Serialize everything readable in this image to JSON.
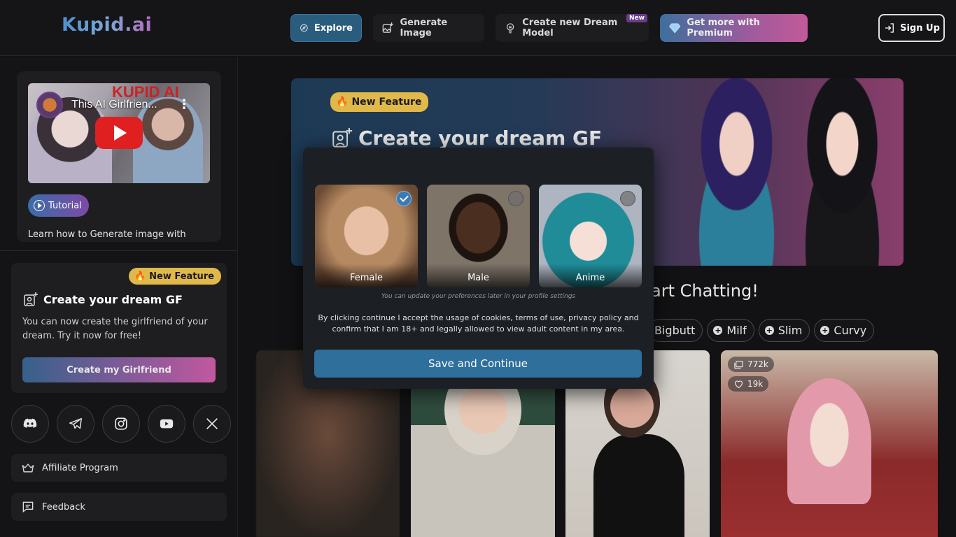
{
  "brand": {
    "logo": "Kupid.ai"
  },
  "nav": {
    "explore": "Explore",
    "generate": "Generate Image",
    "dream_model": "Create new Dream Model",
    "dream_model_tag": "New",
    "premium": "Get more with Premium",
    "signup": "Sign Up"
  },
  "sidebar": {
    "video": {
      "title": "This AI Girlfrien...",
      "overlay_text": "KUPID AI"
    },
    "tutorial_label": "Tutorial",
    "video_desc": "Learn how to Generate image with",
    "gf_card": {
      "badge": "New Feature",
      "title": "Create your dream GF",
      "desc": "You can now create the girlfriend of your dream. Try it now for free!",
      "button": "Create my Girlfriend"
    },
    "socials": [
      "discord-icon",
      "telegram-icon",
      "instagram-icon",
      "youtube-icon",
      "x-icon"
    ],
    "affiliate": "Affiliate Program",
    "feedback": "Feedback"
  },
  "main": {
    "banner": {
      "badge": "New Feature",
      "title": "Create your dream GF"
    },
    "start_chatting": "art Chatting!",
    "tags": [
      "Bigbutt",
      "Milf",
      "Slim",
      "Curvy"
    ],
    "card_stats": {
      "views": "772k",
      "likes": "19k"
    }
  },
  "modal": {
    "options": [
      {
        "label": "Female",
        "selected": true
      },
      {
        "label": "Male",
        "selected": false
      },
      {
        "label": "Anime",
        "selected": false
      }
    ],
    "note": "You can update your preferences later in your profile settings",
    "consent": "By clicking continue I accept the usage of cookies, terms of use, privacy policy and confirm that I am 18+ and legally allowed to view adult content in my area.",
    "button": "Save and Continue"
  },
  "colors": {
    "background": "#121214",
    "accent": "#2e6f9c",
    "badge": "#e0b94a",
    "premium_gradient_start": "#3d6f9d",
    "premium_gradient_end": "#c35a9a"
  }
}
